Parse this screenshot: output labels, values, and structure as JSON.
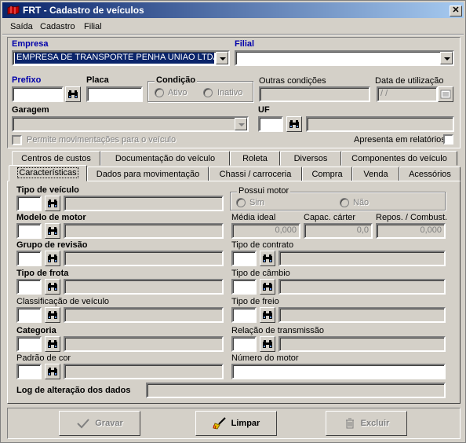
{
  "window": {
    "title": "FRT - Cadastro de veículos",
    "close_label": "✕"
  },
  "menu": [
    "Saída",
    "Cadastro",
    "Filial"
  ],
  "header": {
    "empresa_label": "Empresa",
    "empresa_value": "EMPRESA DE TRANSPORTE PENHA UNIAO LTDA",
    "filial_label": "Filial",
    "filial_value": "",
    "prefixo_label": "Prefixo",
    "placa_label": "Placa",
    "condicao_label": "Condição",
    "ativo_label": "Ativo",
    "inativo_label": "Inativo",
    "outras_label": "Outras condições",
    "data_label": "Data de utilização",
    "data_value": " /  /",
    "garagem_label": "Garagem",
    "uf_label": "UF",
    "permite_label": "Permite movimentações para o veículo",
    "apresenta_label": "Apresenta em relatórios"
  },
  "tabs_row1": [
    "Centros de custos",
    "Documentação do veículo",
    "Roleta",
    "Diversos",
    "Componentes do veículo"
  ],
  "tabs_row2": [
    "Características",
    "Dados para movimentação",
    "Chassi / carroceria",
    "Compra",
    "Venda",
    "Acessórios"
  ],
  "panel": {
    "tipo_veiculo": "Tipo de veículo",
    "modelo_motor": "Modelo de motor",
    "grupo_revisao": "Grupo de revisão",
    "tipo_frota": "Tipo de frota",
    "classificacao": "Classificação de veículo",
    "categoria": "Categoria",
    "padrao_cor": "Padrão de cor",
    "possui_motor": "Possui motor",
    "sim": "Sim",
    "nao": "Não",
    "media_ideal": "Média ideal",
    "media_ideal_value": "0,000",
    "capac_carter": "Capac. cárter",
    "capac_carter_value": "0,0",
    "repos_combust": "Repos. / Combust.",
    "repos_combust_value": "0,000",
    "tipo_contrato": "Tipo de contrato",
    "tipo_cambio": "Tipo de câmbio",
    "tipo_freio": "Tipo de freio",
    "relacao_transmissao": "Relação de transmissão",
    "numero_motor": "Número do motor",
    "log_alteracao": "Log de alteração dos dados"
  },
  "buttons": {
    "gravar": "Gravar",
    "limpar": "Limpar",
    "excluir": "Excluir"
  },
  "colors": {
    "title_start": "#0a246a",
    "title_end": "#a6caf0",
    "label_blue": "#0000aa",
    "face": "#d4d0c8"
  }
}
